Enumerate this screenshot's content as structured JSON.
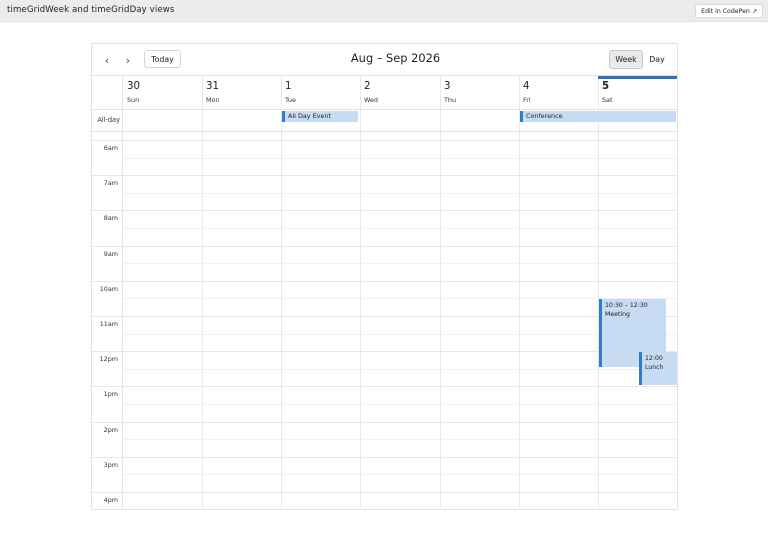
{
  "page": {
    "title": "timeGridWeek and timeGridDay views",
    "codepen_label": "Edit in CodePen",
    "codepen_icon": "↗"
  },
  "toolbar": {
    "prev_icon": "‹",
    "next_icon": "›",
    "today_label": "Today",
    "title": "Aug – Sep 2026",
    "week_label": "Week",
    "day_label": "Day",
    "active_view": "Week"
  },
  "calendar": {
    "all_day_label": "All-day",
    "days": [
      {
        "num": "30",
        "dow": "Sun"
      },
      {
        "num": "31",
        "dow": "Mon"
      },
      {
        "num": "1",
        "dow": "Tue"
      },
      {
        "num": "2",
        "dow": "Wed"
      },
      {
        "num": "3",
        "dow": "Thu"
      },
      {
        "num": "4",
        "dow": "Fri"
      },
      {
        "num": "5",
        "dow": "Sat",
        "today": true
      }
    ],
    "hours": [
      "6am",
      "7am",
      "8am",
      "9am",
      "10am",
      "11am",
      "12pm",
      "1pm",
      "2pm",
      "3pm",
      "4pm"
    ],
    "all_day_events": [
      {
        "title": "All Day Event",
        "start_day": "Tue",
        "end_day": "Tue"
      },
      {
        "title": "Conference",
        "start_day": "Fri",
        "end_day": "Sat"
      }
    ],
    "timed_events": [
      {
        "time": "10:30 – 12:30",
        "title": "Meeting",
        "day": "Sat"
      },
      {
        "time": "12:00",
        "title": "Lunch",
        "day": "Sat"
      }
    ]
  },
  "colors": {
    "event_bg": "#c7dcf2",
    "event_border": "#2f7bd0",
    "today_indicator": "#2a73c4"
  }
}
